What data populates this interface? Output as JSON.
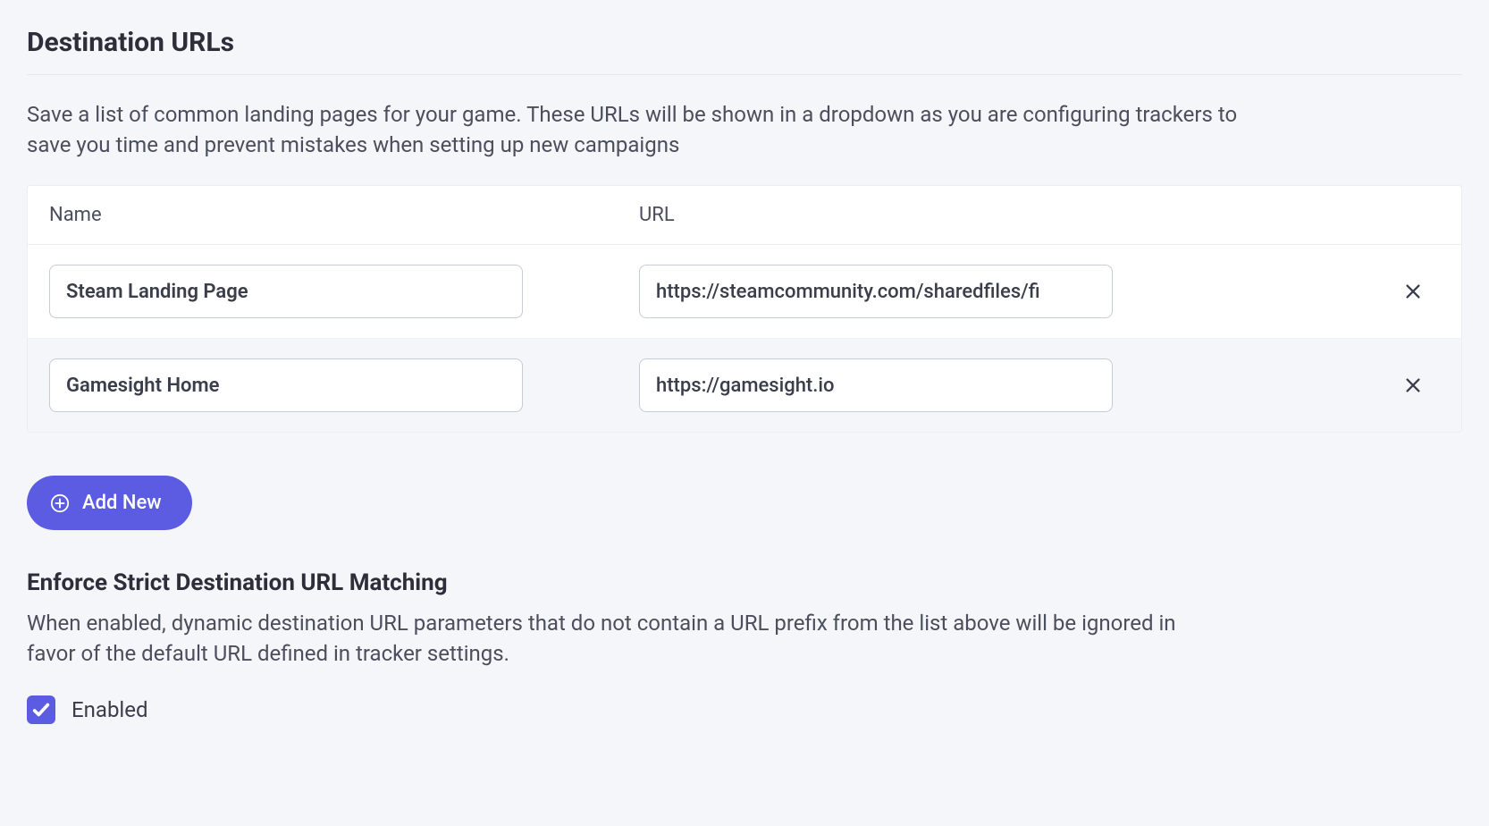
{
  "section": {
    "title": "Destination URLs",
    "description": "Save a list of common landing pages for your game. These URLs will be shown in a dropdown as you are configuring trackers to save you time and prevent mistakes when setting up new campaigns"
  },
  "table": {
    "headers": {
      "name": "Name",
      "url": "URL"
    },
    "rows": [
      {
        "name": "Steam Landing Page",
        "url": "https://steamcommunity.com/sharedfiles/fi"
      },
      {
        "name": "Gamesight Home",
        "url": "https://gamesight.io"
      }
    ]
  },
  "buttons": {
    "add_new": "Add New"
  },
  "enforce_section": {
    "title": "Enforce Strict Destination URL Matching",
    "description": "When enabled, dynamic destination URL parameters that do not contain a URL prefix from the list above will be ignored in favor of the default URL defined in tracker settings.",
    "checkbox_label": "Enabled",
    "checked": true
  }
}
